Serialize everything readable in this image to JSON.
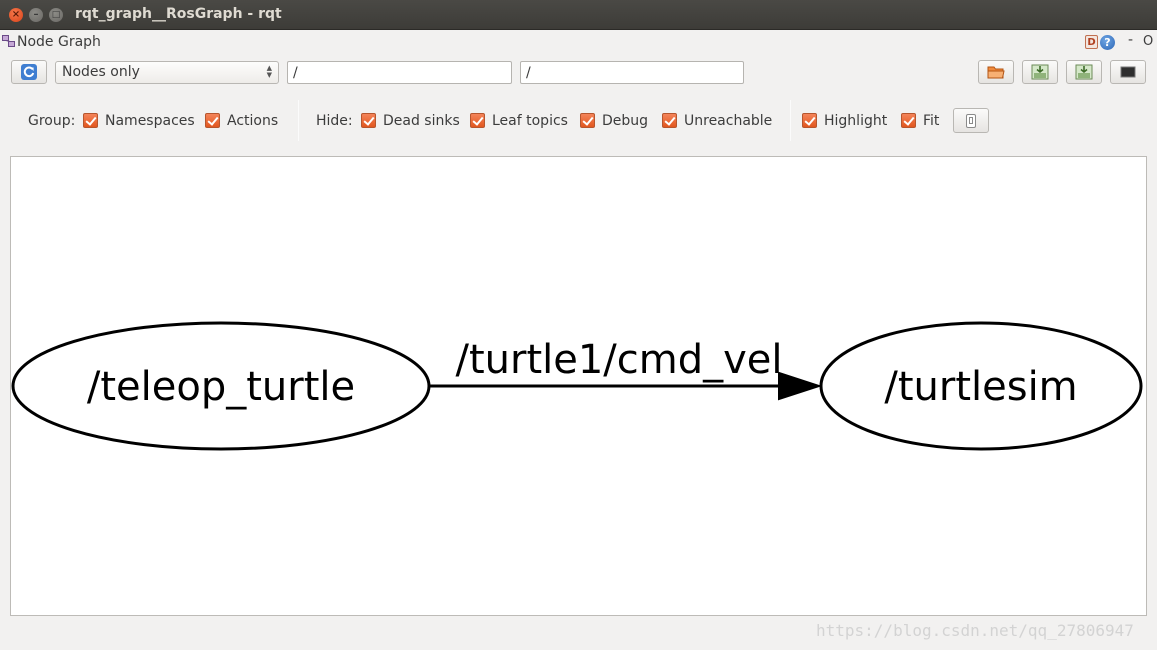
{
  "window": {
    "title": "rqt_graph__RosGraph - rqt",
    "close_glyph": "×",
    "minimize_glyph": "–",
    "maximize_glyph": "□"
  },
  "dock": {
    "title": "Node Graph",
    "d_label": "D",
    "help_label": "?",
    "dash": "-",
    "o_label": "O"
  },
  "toolbar": {
    "mode_select": "Nodes only",
    "filter1_value": "/",
    "filter2_value": "/"
  },
  "options": {
    "group_label": "Group:",
    "namespaces": "Namespaces",
    "actions": "Actions",
    "hide_label": "Hide:",
    "dead_sinks": "Dead sinks",
    "leaf_topics": "Leaf topics",
    "debug": "Debug",
    "unreachable": "Unreachable",
    "highlight": "Highlight",
    "fit": "Fit"
  },
  "graph": {
    "nodes": [
      {
        "name": "/teleop_turtle"
      },
      {
        "name": "/turtlesim"
      }
    ],
    "edges": [
      {
        "label": "/turtle1/cmd_vel",
        "from": "/teleop_turtle",
        "to": "/turtlesim"
      }
    ]
  },
  "watermark": "https://blog.csdn.net/qq_27806947",
  "colors": {
    "titlebar": "#3d3c38",
    "checkbox": "#e2571f",
    "canvas": "#ffffff"
  }
}
